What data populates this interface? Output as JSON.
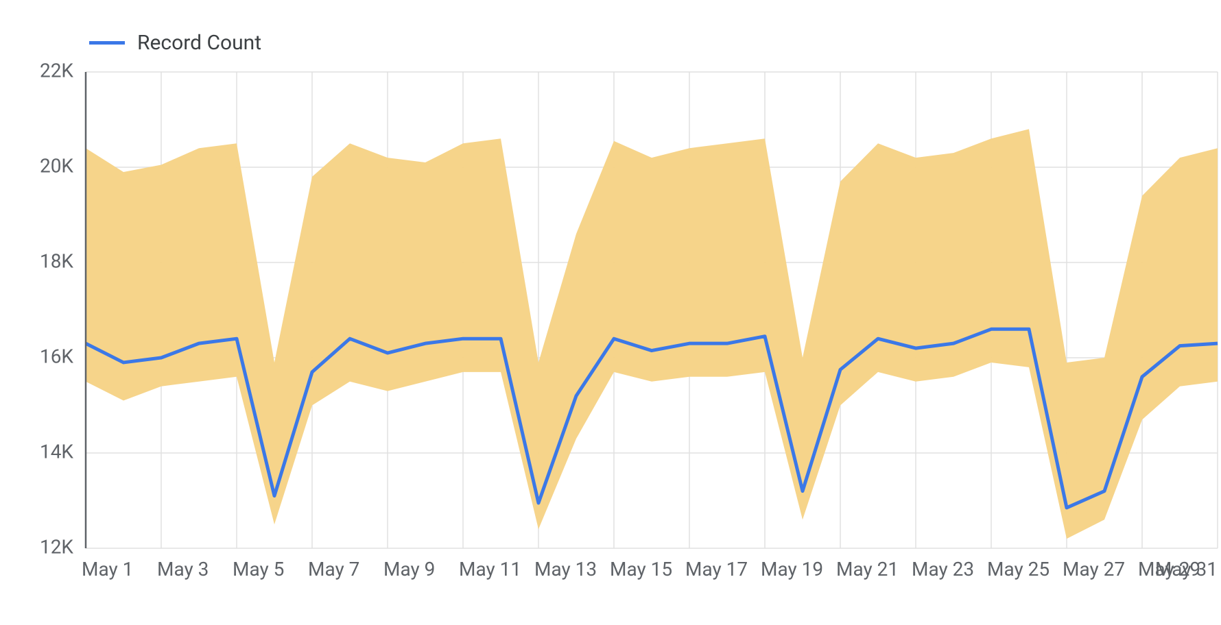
{
  "legend": {
    "series_label": "Record Count"
  },
  "chart_data": {
    "type": "line",
    "title": "",
    "xlabel": "",
    "ylabel": "",
    "ylim": [
      12000,
      22000
    ],
    "y_ticks": [
      12000,
      14000,
      16000,
      18000,
      20000,
      22000
    ],
    "y_tick_labels": [
      "12K",
      "14K",
      "16K",
      "18K",
      "20K",
      "22K"
    ],
    "x_tick_labels": [
      "May 1",
      "May 3",
      "May 5",
      "May 7",
      "May 9",
      "May 11",
      "May 13",
      "May 15",
      "May 17",
      "May 19",
      "May 21",
      "May 23",
      "May 25",
      "May 27",
      "May 29",
      "May 31"
    ],
    "x_tick_indices": [
      0,
      2,
      4,
      6,
      8,
      10,
      12,
      14,
      16,
      18,
      20,
      22,
      24,
      26,
      28,
      30
    ],
    "categories": [
      "May 1",
      "May 2",
      "May 3",
      "May 4",
      "May 5",
      "May 6",
      "May 7",
      "May 8",
      "May 9",
      "May 10",
      "May 11",
      "May 12",
      "May 13",
      "May 14",
      "May 15",
      "May 16",
      "May 17",
      "May 18",
      "May 19",
      "May 20",
      "May 21",
      "May 22",
      "May 23",
      "May 24",
      "May 25",
      "May 26",
      "May 27",
      "May 28",
      "May 29",
      "May 30",
      "May 31"
    ],
    "series": [
      {
        "name": "Record Count",
        "values": [
          16300,
          15900,
          16000,
          16300,
          16400,
          13100,
          15700,
          16400,
          16100,
          16300,
          16400,
          16400,
          12950,
          15200,
          16400,
          16150,
          16300,
          16300,
          16450,
          13200,
          15750,
          16400,
          16200,
          16300,
          16600,
          16600,
          12850,
          13200,
          15600,
          16250,
          16300
        ]
      }
    ],
    "band": {
      "upper": [
        20400,
        19900,
        20050,
        20400,
        20500,
        15900,
        19800,
        20500,
        20200,
        20100,
        20500,
        20600,
        15900,
        18600,
        20550,
        20200,
        20400,
        20500,
        20600,
        16000,
        19700,
        20500,
        20200,
        20300,
        20600,
        20800,
        15900,
        16000,
        19400,
        20200,
        20400
      ],
      "lower": [
        15500,
        15100,
        15400,
        15500,
        15600,
        12500,
        15000,
        15500,
        15300,
        15500,
        15700,
        15700,
        12400,
        14300,
        15700,
        15500,
        15600,
        15600,
        15700,
        12600,
        15000,
        15700,
        15500,
        15600,
        15900,
        15800,
        12200,
        12600,
        14700,
        15400,
        15500
      ]
    },
    "legend_position": "top-left",
    "grid": true
  }
}
